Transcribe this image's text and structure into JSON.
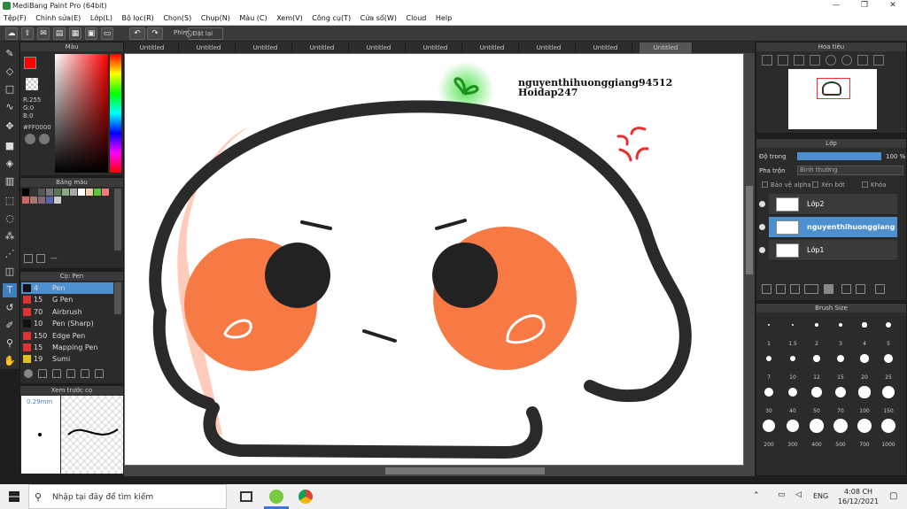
{
  "app": {
    "title": "MediBang Paint Pro (64bit)"
  },
  "menu": [
    "Tệp(F)",
    "Chỉnh sửa(E)",
    "Lớp(L)",
    "Bộ lọc(R)",
    "Chọn(S)",
    "Chụp(N)",
    "Màu (C)",
    "Xem(V)",
    "Công cụ(T)",
    "Cửa sổ(W)",
    "Cloud",
    "Help"
  ],
  "toolbar": {
    "shortcut_label": "Phím",
    "reset_label": "Đặt lại"
  },
  "color_panel": {
    "title": "Màu",
    "r": "R:255",
    "g": "G:0",
    "b": "B:0",
    "hex": "#FF0000",
    "fg": "#ff0000",
    "bg": "#000000"
  },
  "palette_panel": {
    "title": "Bảng màu",
    "more": "---",
    "swatches": [
      "#000000",
      "#333333",
      "#555555",
      "#777777",
      "#557755",
      "#88aa88",
      "#aaaaaa",
      "#ffffff",
      "#eeccaa",
      "#55cc33",
      "#ff7777",
      "#cc6666",
      "#aa7777",
      "#886677",
      "#5566aa",
      "#cccccc"
    ]
  },
  "brush_panel": {
    "title": "Cọ: Pen",
    "items": [
      {
        "size": "4",
        "name": "Pen",
        "color": "#111111"
      },
      {
        "size": "15",
        "name": "G Pen",
        "color": "#dd3333"
      },
      {
        "size": "70",
        "name": "Airbrush",
        "color": "#dd3333"
      },
      {
        "size": "10",
        "name": "Pen (Sharp)",
        "color": "#111111"
      },
      {
        "size": "150",
        "name": "Edge Pen",
        "color": "#dd3333"
      },
      {
        "size": "15",
        "name": "Mapping Pen",
        "color": "#dd3333"
      },
      {
        "size": "19",
        "name": "Sumi",
        "color": "#e0c020"
      }
    ]
  },
  "preview_panel": {
    "title": "Xem trước cọ",
    "size": "0.29mm"
  },
  "tabs": [
    "Untitled",
    "Untitled",
    "Untitled",
    "Untitled",
    "Untitled",
    "Untitled",
    "Untitled",
    "Untitled",
    "Untitled",
    "Untitled"
  ],
  "canvas": {
    "text_line1": "nguyenthihuonggiang94512",
    "text_line2": "Hoidap247"
  },
  "navigator": {
    "title": "Hoa tiêu"
  },
  "layer_panel": {
    "title": "Lớp",
    "opacity_label": "Độ trong",
    "opacity_value": "100 %",
    "blend_label": "Pha trộn",
    "blend_value": "Bình thường",
    "protect_alpha": "Bảo vệ alpha",
    "clipping": "Xén bớt",
    "lock": "Khóa",
    "layers": [
      {
        "name": "Lớp2"
      },
      {
        "name": "nguyenthihuonggiang"
      },
      {
        "name": "Lớp1"
      }
    ]
  },
  "size_panel": {
    "title": "Brush Size",
    "sizes": [
      "1",
      "1.5",
      "2",
      "3",
      "4",
      "5",
      "7",
      "10",
      "12",
      "15",
      "20",
      "25",
      "30",
      "40",
      "50",
      "70",
      "100",
      "150",
      "200",
      "300",
      "400",
      "500",
      "700",
      "1000"
    ]
  },
  "taskbar": {
    "search_placeholder": "Nhập tại đây để tìm kiếm",
    "lang": "ENG",
    "time": "4:08 CH",
    "date": "16/12/2021"
  }
}
